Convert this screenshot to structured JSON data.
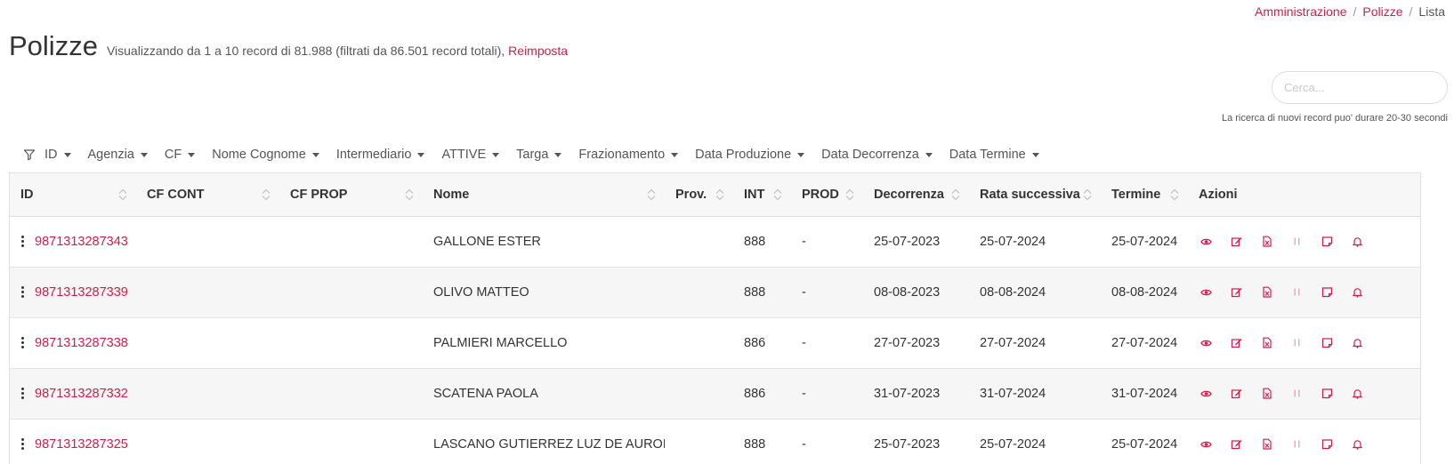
{
  "breadcrumb": {
    "items": [
      "Amministrazione",
      "Polizze"
    ],
    "current": "Lista",
    "separator": "/"
  },
  "header": {
    "title": "Polizze",
    "subtitle": "Visualizzando da 1 a 10 record di 81.988 (filtrati da 86.501 record totali),",
    "reset_label": "Reimposta"
  },
  "search": {
    "placeholder": "Cerca...",
    "note": "La ricerca di nuovi record puo' durare 20-30 secondi"
  },
  "filters": [
    "ID",
    "Agenzia",
    "CF",
    "Nome Cognome",
    "Intermediario",
    "ATTIVE",
    "Targa",
    "Frazionamento",
    "Data Produzione",
    "Data Decorrenza",
    "Data Termine"
  ],
  "table": {
    "columns": [
      "ID",
      "CF CONT",
      "CF PROP",
      "Nome",
      "Prov.",
      "INT",
      "PROD",
      "Decorrenza",
      "Rata successiva",
      "Termine",
      "Azioni"
    ],
    "rows": [
      {
        "id": "9871313287343",
        "cf_cont": "",
        "cf_prop": "",
        "nome": "GALLONE ESTER",
        "prov": "",
        "int": "888",
        "prod": "-",
        "decorrenza": "25-07-2023",
        "rata": "25-07-2024",
        "termine": "25-07-2024"
      },
      {
        "id": "9871313287339",
        "cf_cont": "",
        "cf_prop": "",
        "nome": "OLIVO MATTEO",
        "prov": "",
        "int": "888",
        "prod": "-",
        "decorrenza": "08-08-2023",
        "rata": "08-08-2024",
        "termine": "08-08-2024"
      },
      {
        "id": "9871313287338",
        "cf_cont": "",
        "cf_prop": "",
        "nome": "PALMIERI MARCELLO",
        "prov": "",
        "int": "886",
        "prod": "-",
        "decorrenza": "27-07-2023",
        "rata": "27-07-2024",
        "termine": "27-07-2024"
      },
      {
        "id": "9871313287332",
        "cf_cont": "",
        "cf_prop": "",
        "nome": "SCATENA PAOLA",
        "prov": "",
        "int": "886",
        "prod": "-",
        "decorrenza": "31-07-2023",
        "rata": "31-07-2024",
        "termine": "31-07-2024"
      },
      {
        "id": "9871313287325",
        "cf_cont": "",
        "cf_prop": "",
        "nome": "LASCANO GUTIERREZ LUZ DE AURORA",
        "prov": "",
        "int": "888",
        "prod": "-",
        "decorrenza": "25-07-2023",
        "rata": "25-07-2024",
        "termine": "25-07-2024"
      }
    ],
    "actions": [
      "eye-icon",
      "edit-icon",
      "pdf-file-icon",
      "pause-icon",
      "note-icon",
      "bell-icon"
    ]
  },
  "colors": {
    "accent": "#d21d4b",
    "text": "#333333",
    "header_bg": "#f7f7f7",
    "stripe_bg": "#f6f6f6"
  }
}
